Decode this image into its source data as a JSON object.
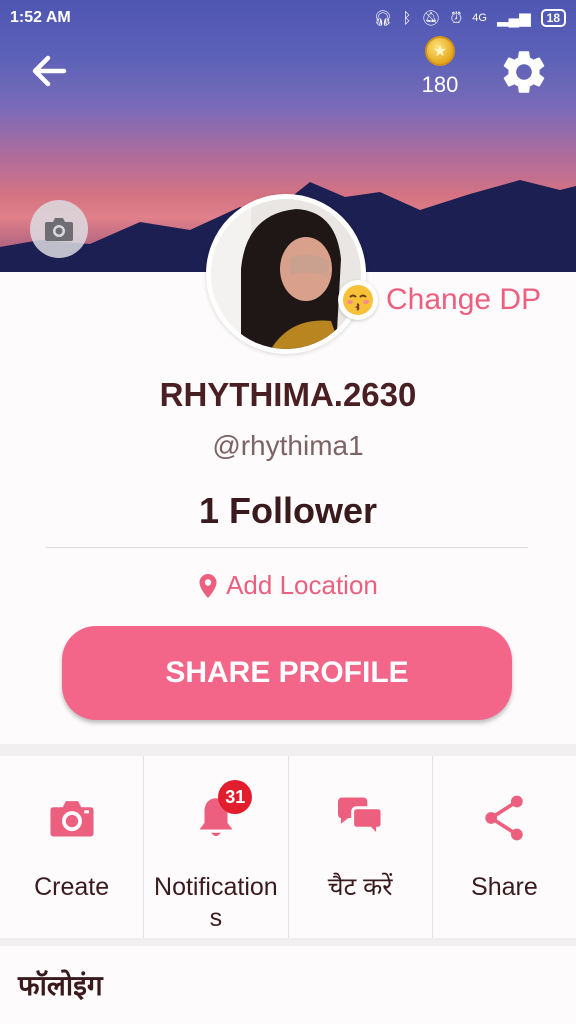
{
  "status_bar": {
    "time": "1:52 AM",
    "network": "4G",
    "battery": "18"
  },
  "header": {
    "back_icon": "arrow-left-icon",
    "coin_icon": "coin-icon",
    "coins": "180",
    "settings_icon": "gear-icon",
    "cover_camera_icon": "camera-icon"
  },
  "profile": {
    "change_dp_label": "Change DP",
    "username": "RHYTHIMA.2630",
    "handle": "@rhythima1",
    "followers": "1 Follower",
    "location_label": "Add Location",
    "share_button": "SHARE PROFILE"
  },
  "actions": [
    {
      "label": "Create",
      "icon": "camera-icon"
    },
    {
      "label": "Notifications",
      "icon": "bell-icon",
      "badge": "31"
    },
    {
      "label": "चैट करें",
      "icon": "chat-icon"
    },
    {
      "label": "Share",
      "icon": "share-icon"
    }
  ],
  "following": {
    "title": "फॉलोइंग"
  },
  "colors": {
    "accent": "#f3668a",
    "accent_text": "#ec5f7f",
    "badge": "#e21e2e",
    "text_dark": "#3b1a1e"
  }
}
